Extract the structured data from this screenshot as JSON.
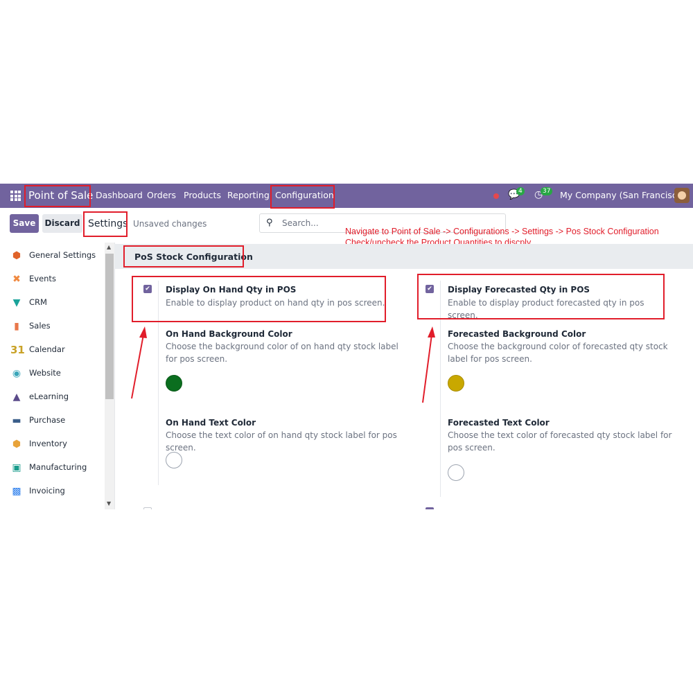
{
  "navbar": {
    "app_name": "Point of Sale",
    "menu": [
      "Dashboard",
      "Orders",
      "Products",
      "Reporting",
      "Configuration"
    ],
    "messages_count": "4",
    "activities_count": "37",
    "company": "My Company (San Francisco)"
  },
  "control_panel": {
    "save_label": "Save",
    "discard_label": "Discard",
    "title": "Settings",
    "status": "Unsaved changes",
    "search_placeholder": "Search..."
  },
  "annotation": {
    "line1": "Navigate to Point of Sale -> Configurations -> Settings -> Pos Stock Configuration",
    "line2": "Check/uncheck the Product Quantities to discply"
  },
  "sidebar": {
    "items": [
      {
        "label": "General Settings",
        "icon": "general-settings-icon",
        "color": "#e0632a"
      },
      {
        "label": "Events",
        "icon": "events-icon",
        "color": "#f0883e"
      },
      {
        "label": "CRM",
        "icon": "crm-icon",
        "color": "#1aa39a"
      },
      {
        "label": "Sales",
        "icon": "sales-icon",
        "color": "#e8774a"
      },
      {
        "label": "Calendar",
        "icon": "calendar-icon",
        "color": "#c9a227"
      },
      {
        "label": "Website",
        "icon": "website-icon",
        "color": "#3aa6b9"
      },
      {
        "label": "eLearning",
        "icon": "elearning-icon",
        "color": "#5b4b8a"
      },
      {
        "label": "Purchase",
        "icon": "purchase-icon",
        "color": "#3b5f8a"
      },
      {
        "label": "Inventory",
        "icon": "inventory-icon",
        "color": "#e8a33a"
      },
      {
        "label": "Manufacturing",
        "icon": "manufacturing-icon",
        "color": "#1a9c8c"
      },
      {
        "label": "Invoicing",
        "icon": "invoicing-icon",
        "color": "#2f80ed"
      }
    ]
  },
  "section": {
    "title": "PoS Stock Configuration",
    "left": {
      "checkbox_title": "Display On Hand Qty in POS",
      "checkbox_desc": "Enable to display product on hand qty in pos screen.",
      "checked": true,
      "bg_title": "On Hand Background Color",
      "bg_desc": "Choose the background color of on hand qty stock label for pos screen.",
      "bg_color": "#0b6e1f",
      "text_title": "On Hand Text Color",
      "text_desc": "Choose the text color of on hand qty stock label for pos screen.",
      "text_color": "#ffffff"
    },
    "right": {
      "checkbox_title": "Display Forecasted Qty in POS",
      "checkbox_desc": "Enable to display product forecasted qty in pos screen.",
      "checked": true,
      "bg_title": "Forecasted Background Color",
      "bg_desc": "Choose the background color of forecasted qty stock label for pos screen.",
      "bg_color": "#c9a800",
      "text_title": "Forecasted Text Color",
      "text_desc": "Choose the text color of forecasted qty stock label for pos screen.",
      "text_color": "#ffffff"
    }
  },
  "colors": {
    "primary": "#71639e",
    "highlight": "#e11d2a"
  }
}
